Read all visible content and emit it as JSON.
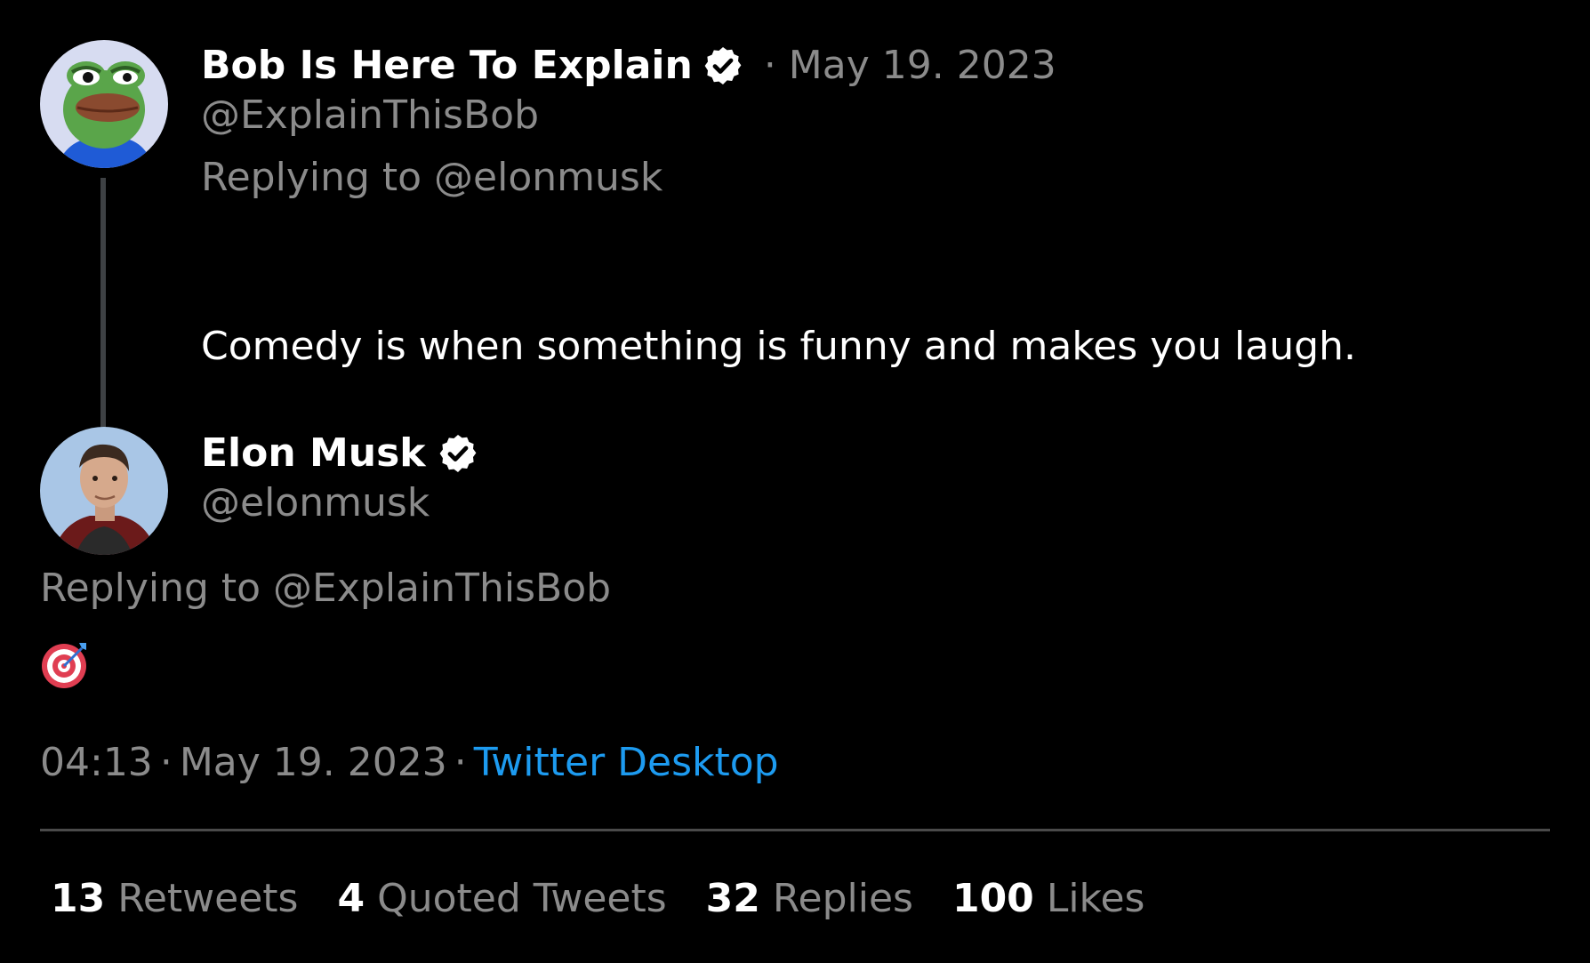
{
  "parent_tweet": {
    "display_name": "Bob Is Here To Explain",
    "verified": true,
    "date": "· May 19. 2023",
    "handle": "@ExplainThisBob",
    "replying_to": "Replying to @elonmusk",
    "text": "Comedy is when something is funny and makes you laugh."
  },
  "main_tweet": {
    "display_name": "Elon Musk",
    "verified": true,
    "handle": "@elonmusk",
    "replying_to": "Replying to @ExplainThisBob",
    "content_emoji": "direct-hit-target-icon",
    "time": "04:13",
    "date": "May 19. 2023",
    "separator": "·",
    "source": "Twitter Desktop"
  },
  "stats": {
    "retweets_count": "13",
    "retweets_label": "Retweets",
    "quotes_count": "4",
    "quotes_label": "Quoted Tweets",
    "replies_count": "32",
    "replies_label": "Replies",
    "likes_count": "100",
    "likes_label": "Likes"
  },
  "colors": {
    "background": "#000000",
    "primary_text": "#ffffff",
    "secondary_text": "#8b8b8b",
    "link": "#1d9bf0",
    "thread_line": "#3e4144"
  }
}
